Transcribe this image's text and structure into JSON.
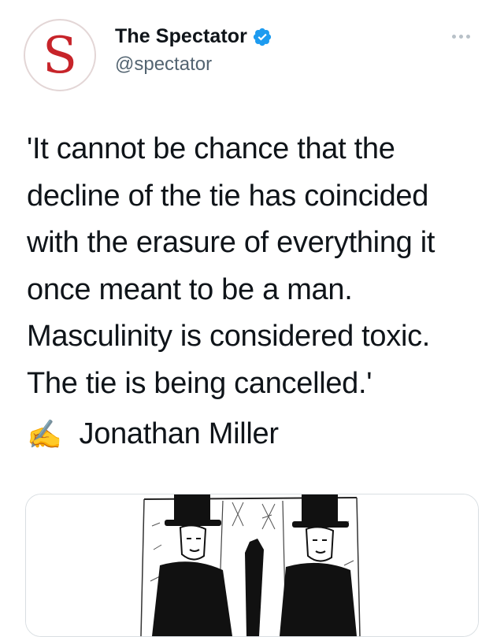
{
  "account": {
    "display_name": "The Spectator",
    "handle": "@spectator",
    "avatar_letter": "S",
    "verified": true,
    "avatar_color": "#c7242a",
    "verified_color": "#1d9bf0"
  },
  "tweet": {
    "lines": [
      "'It cannot be chance that the",
      "decline of the tie has coincided",
      "with the erasure of everything it",
      "once meant to be a man.",
      "Masculinity is considered toxic.",
      "The tie is being cancelled.'"
    ],
    "byline_emoji": "✍️",
    "byline_author": "Jonathan Miller"
  },
  "icons": {
    "more": "more-options-icon",
    "verified": "verified-badge-icon",
    "writing_hand": "writing-hand-icon"
  },
  "card": {
    "image_description_icon": "cartoon-illustration"
  }
}
